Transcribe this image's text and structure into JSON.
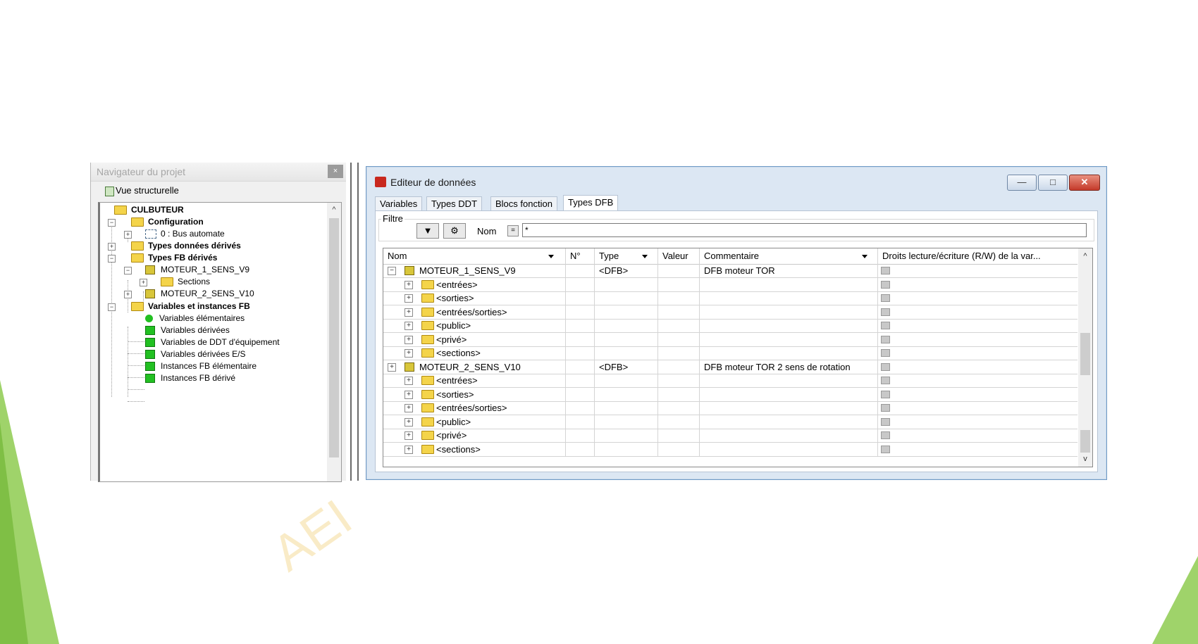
{
  "navigator": {
    "title": "Navigateur du projet",
    "close": "×",
    "view_label": "Vue structurelle",
    "tree": [
      {
        "label": "CULBUTEUR",
        "bold": true
      },
      {
        "label": "Configuration",
        "bold": true
      },
      {
        "label": "0 : Bus automate",
        "bold": false
      },
      {
        "label": "Types données dérivés",
        "bold": true
      },
      {
        "label": "Types FB dérivés",
        "bold": true
      },
      {
        "label": "MOTEUR_1_SENS_V9",
        "bold": false
      },
      {
        "label": "Sections",
        "bold": false
      },
      {
        "label": "MOTEUR_2_SENS_V10",
        "bold": false
      },
      {
        "label": "Variables et instances FB",
        "bold": true
      },
      {
        "label": "Variables élémentaires",
        "bold": false
      },
      {
        "label": "Variables dérivées",
        "bold": false
      },
      {
        "label": "Variables de DDT d'équipement",
        "bold": false
      },
      {
        "label": "Variables dérivées E/S",
        "bold": false
      },
      {
        "label": "Instances FB élémentaire",
        "bold": false
      },
      {
        "label": "Instances FB dérivé",
        "bold": false
      }
    ]
  },
  "editor": {
    "title": "Editeur de données",
    "tabs": [
      "Variables",
      "Types DDT",
      "Blocs fonction",
      "Types DFB"
    ],
    "active_tab": "Types DFB",
    "filter": {
      "label": "Filtre",
      "name_label": "Nom",
      "equals": "=",
      "value": "*"
    },
    "columns": [
      "Nom",
      "N°",
      "Type",
      "Valeur",
      "Commentaire",
      "Droits lecture/écriture (R/W) de la var..."
    ],
    "rows": [
      {
        "name": "MOTEUR_1_SENS_V9",
        "type": "<DFB>",
        "comment": "DFB moteur TOR",
        "level": 0,
        "expander": "−"
      },
      {
        "name": "<entrées>",
        "type": "",
        "comment": "",
        "level": 1,
        "expander": "+"
      },
      {
        "name": "<sorties>",
        "type": "",
        "comment": "",
        "level": 1,
        "expander": "+"
      },
      {
        "name": "<entrées/sorties>",
        "type": "",
        "comment": "",
        "level": 1,
        "expander": "+"
      },
      {
        "name": "<public>",
        "type": "",
        "comment": "",
        "level": 1,
        "expander": "+"
      },
      {
        "name": "<privé>",
        "type": "",
        "comment": "",
        "level": 1,
        "expander": "+"
      },
      {
        "name": "<sections>",
        "type": "",
        "comment": "",
        "level": 1,
        "expander": "+"
      },
      {
        "name": "MOTEUR_2_SENS_V10",
        "type": "<DFB>",
        "comment": "DFB moteur TOR 2 sens de rotation",
        "level": 0,
        "expander": "+"
      },
      {
        "name": "<entrées>",
        "type": "",
        "comment": "",
        "level": 1,
        "expander": "+"
      },
      {
        "name": "<sorties>",
        "type": "",
        "comment": "",
        "level": 1,
        "expander": "+"
      },
      {
        "name": "<entrées/sorties>",
        "type": "",
        "comment": "",
        "level": 1,
        "expander": "+"
      },
      {
        "name": "<public>",
        "type": "",
        "comment": "",
        "level": 1,
        "expander": "+"
      },
      {
        "name": "<privé>",
        "type": "",
        "comment": "",
        "level": 1,
        "expander": "+"
      },
      {
        "name": "<sections>",
        "type": "",
        "comment": "",
        "level": 1,
        "expander": "+"
      }
    ]
  },
  "watermark": "AEI",
  "colors": {
    "accent_green": "#9fd36a",
    "window_border": "#6f9ac6",
    "close_red": "#c4392a"
  }
}
